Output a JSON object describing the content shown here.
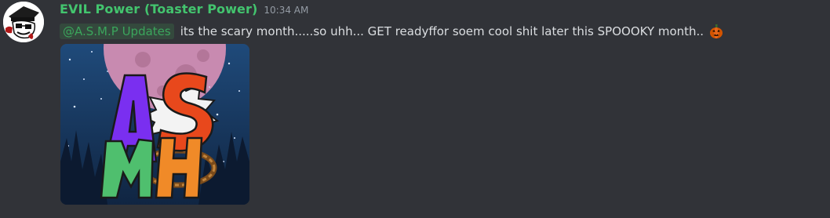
{
  "message": {
    "author": "EVIL Power (Toaster Power)",
    "timestamp": "10:34 AM",
    "mention": "@A.S.M.P Updates",
    "text": "its the scary month.....so uhh... GET readyffor soem cool shit later this SPOOOKY month..",
    "emoji": "jack-o-lantern-emoji",
    "attachment_image": "asmh-logo-image",
    "attachment_lettering": "ASMH"
  },
  "colors": {
    "background": "#313338",
    "username": "#43c46e",
    "timestamp": "#949ba4",
    "body_text": "#dbdee1",
    "mention_text": "#3ba55c"
  }
}
